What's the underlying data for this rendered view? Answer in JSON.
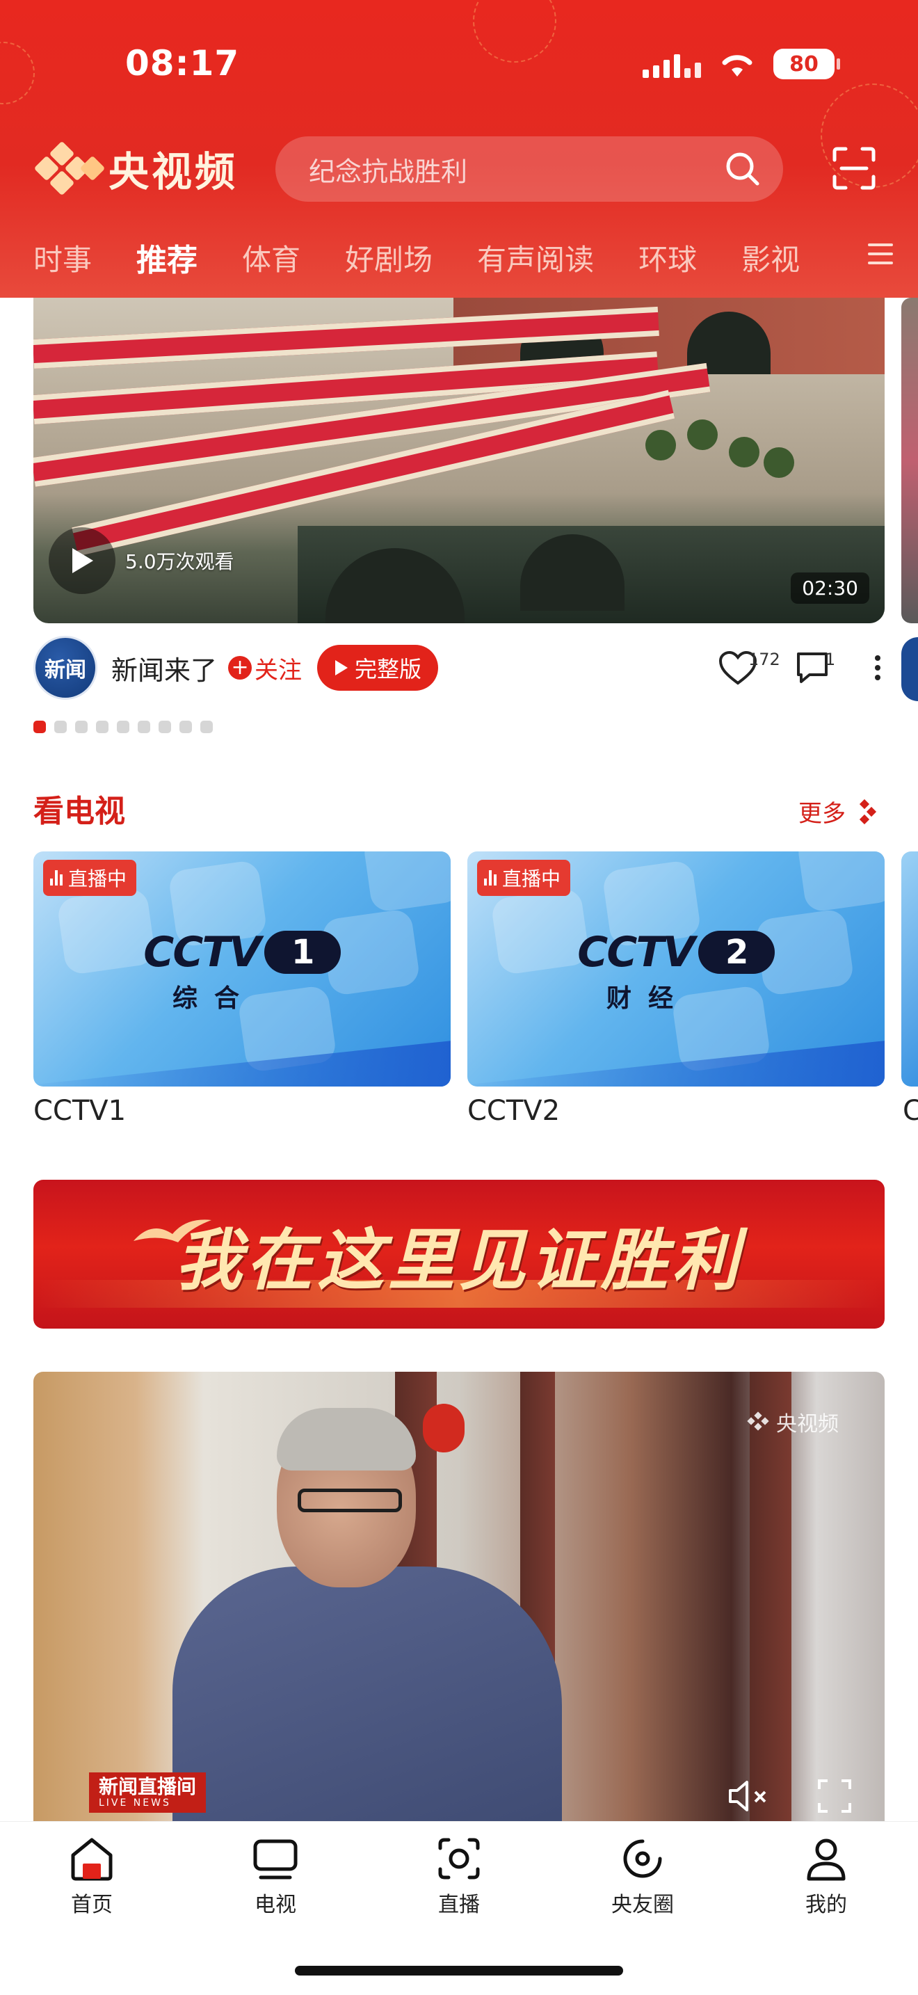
{
  "status_bar": {
    "time": "08:17",
    "battery": "80"
  },
  "header": {
    "app_name": "央视频",
    "search_placeholder": "纪念抗战胜利",
    "tabs": [
      {
        "label": "时事",
        "active": false
      },
      {
        "label": "推荐",
        "active": true
      },
      {
        "label": "体育",
        "active": false
      },
      {
        "label": "好剧场",
        "active": false
      },
      {
        "label": "有声阅读",
        "active": false
      },
      {
        "label": "环球",
        "active": false
      },
      {
        "label": "影视",
        "active": false
      }
    ]
  },
  "hero": {
    "views": "5.0万次观看",
    "duration": "02:30",
    "author": "新闻来了",
    "avatar_text": "新闻",
    "follow_label": "关注",
    "full_label": "完整版",
    "likes": "172",
    "comments": "1",
    "page_count": 9,
    "active_page": 0
  },
  "tv_section": {
    "title": "看电视",
    "more_label": "更多",
    "live_label": "直播中",
    "channels": [
      {
        "name": "CCTV1",
        "logo_num": "1",
        "logo_sub": "综合"
      },
      {
        "name": "CCTV2",
        "logo_num": "2",
        "logo_sub": "财经"
      }
    ],
    "peek_label": "C"
  },
  "banner": {
    "text": "我在这里见证胜利"
  },
  "video2": {
    "watermark": "央视频",
    "channel_logo": "新闻直播间",
    "channel_logo_en": "LIVE NEWS"
  },
  "bottom_nav": [
    {
      "label": "首页",
      "icon": "home-icon",
      "active": true
    },
    {
      "label": "电视",
      "icon": "tv-icon",
      "active": false
    },
    {
      "label": "直播",
      "icon": "live-icon",
      "active": false
    },
    {
      "label": "央友圈",
      "icon": "circle-icon",
      "active": false
    },
    {
      "label": "我的",
      "icon": "profile-icon",
      "active": false
    }
  ],
  "colors": {
    "brand_red": "#e2231a",
    "accent_section": "#d42019"
  }
}
